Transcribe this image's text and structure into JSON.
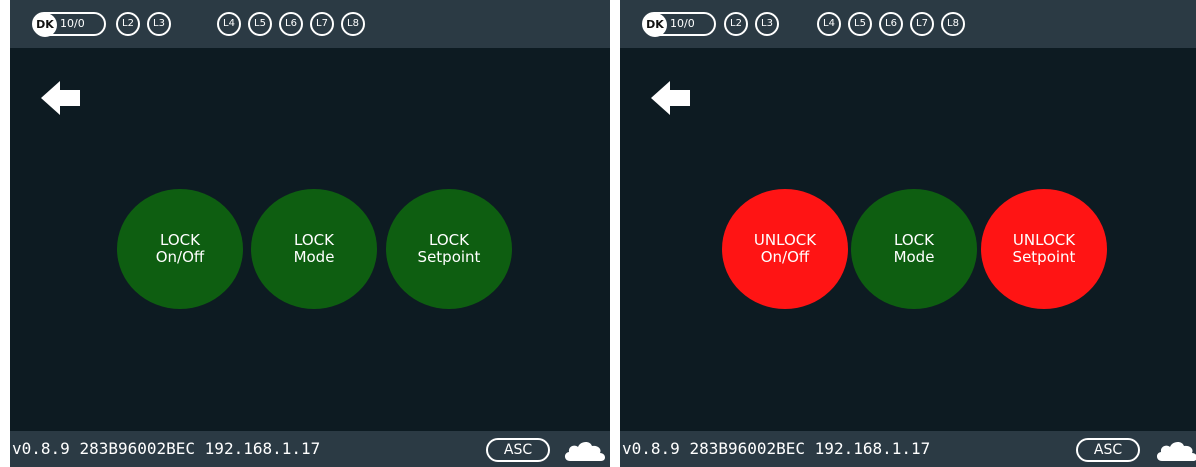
{
  "header": {
    "dk_label": "DK",
    "count_label": "10/0",
    "zones": [
      "L2",
      "L3",
      "L4",
      "L5",
      "L6",
      "L7",
      "L8"
    ]
  },
  "left_panel": {
    "buttons": [
      {
        "line1": "LOCK",
        "line2": "On/Off",
        "color": "#0e5e11"
      },
      {
        "line1": "LOCK",
        "line2": "Mode",
        "color": "#0e5e11"
      },
      {
        "line1": "LOCK",
        "line2": "Setpoint",
        "color": "#0e5e11"
      }
    ]
  },
  "right_panel": {
    "buttons": [
      {
        "line1": "UNLOCK",
        "line2": "On/Off",
        "color": "#ff1414"
      },
      {
        "line1": "LOCK",
        "line2": "Mode",
        "color": "#0e5e11"
      },
      {
        "line1": "UNLOCK",
        "line2": "Setpoint",
        "color": "#ff1414"
      }
    ]
  },
  "status": {
    "version": "v0.8.9",
    "device_id": "283B96002BEC",
    "ip": "192.168.1.17",
    "mode_label": "ASC",
    "cloud_icon": "cloud-icon"
  },
  "colors": {
    "background": "#0d1b22",
    "bar": "#2b3a44",
    "lock_green": "#0e5e11",
    "unlock_red": "#ff1414"
  }
}
